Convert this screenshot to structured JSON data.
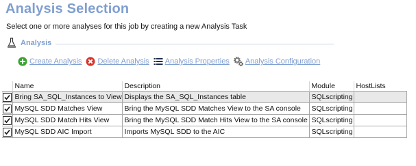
{
  "page": {
    "title": "Analysis Selection",
    "subtitle": "Select one or more analyses for this job by creating a new Analysis Task"
  },
  "section": {
    "label": "Analysis",
    "icon": "flask-icon"
  },
  "toolbar": {
    "create_label": "Create Analysis",
    "delete_label": "Delete Analysis",
    "properties_label": "Analysis Properties",
    "configuration_label": "Analysis Configuration"
  },
  "table": {
    "columns": {
      "name": "Name",
      "description": "Description",
      "module": "Module",
      "hostlists": "HostLists"
    },
    "rows": [
      {
        "checked": true,
        "name": "Bring SA_SQL_Instances to View",
        "description": "Displays the SA_SQL_Instances table",
        "module": "SQLscripting",
        "hostlists": ""
      },
      {
        "checked": true,
        "name": "MySQL SDD Matches View",
        "description": "Bring the MySQL SDD Matches View to the SA console",
        "module": "SQLscripting",
        "hostlists": ""
      },
      {
        "checked": true,
        "name": "MySQL SDD Match Hits View",
        "description": "Bring the MySQL SDD Match Hits View to the SA console",
        "module": "SQLscripting",
        "hostlists": ""
      },
      {
        "checked": true,
        "name": "MySQL SDD AIC Import",
        "description": "Imports MySQL SDD to the AIC",
        "module": "SQLscripting",
        "hostlists": ""
      }
    ]
  },
  "colors": {
    "accent": "#7f9fd0",
    "create_icon": "#3aa335",
    "delete_icon": "#d9342b",
    "selected_row": "#e9e9e9"
  }
}
